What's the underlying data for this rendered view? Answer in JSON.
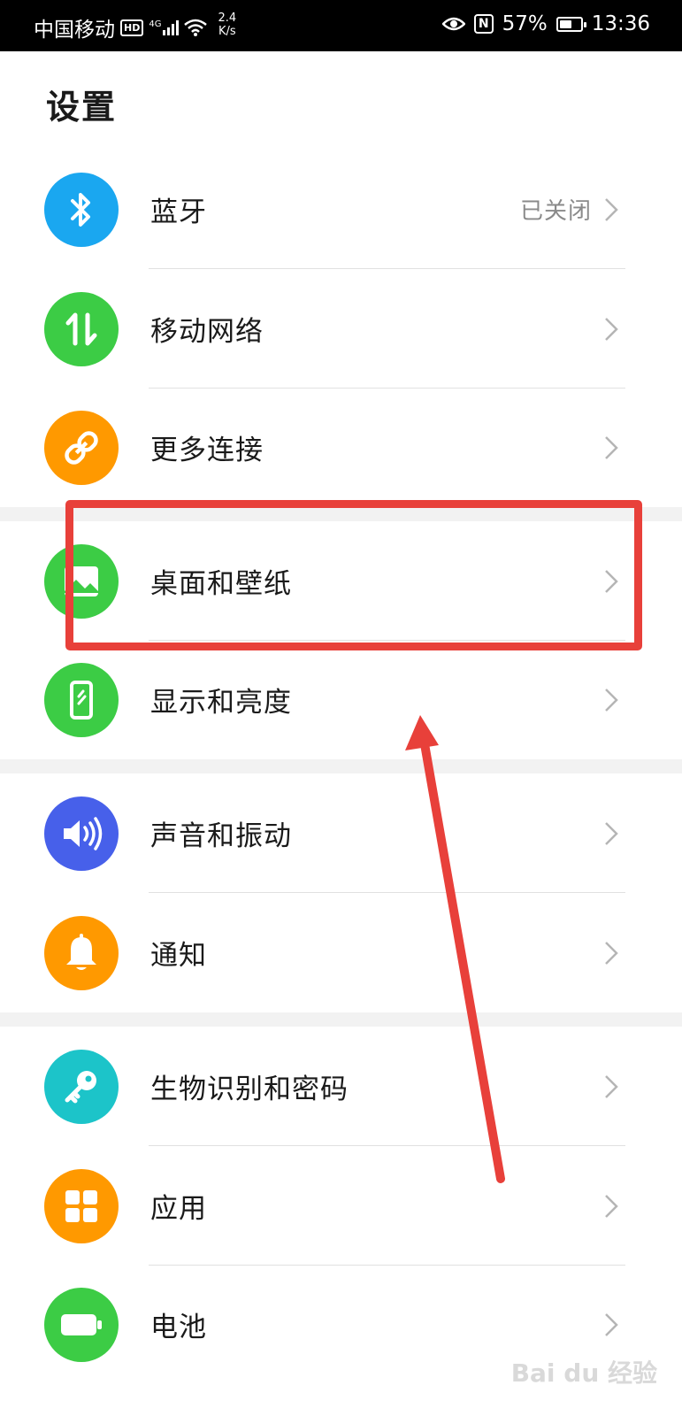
{
  "status_bar": {
    "carrier": "中国移动",
    "hd": "HD",
    "network": "4G",
    "speed_value": "2.4",
    "speed_unit": "K/s",
    "nfc": "N",
    "battery_percent": "57%",
    "battery_level": 0.57,
    "time": "13:36"
  },
  "page_title": "设置",
  "items": [
    {
      "label": "蓝牙",
      "status": "已关闭",
      "icon": "bluetooth-icon",
      "color": "#1aa7f0"
    },
    {
      "label": "移动网络",
      "status": "",
      "icon": "mobile-data-icon",
      "color": "#3ccc45"
    },
    {
      "label": "更多连接",
      "status": "",
      "icon": "link-icon",
      "color": "#ff9900"
    },
    {
      "label": "桌面和壁纸",
      "status": "",
      "icon": "wallpaper-icon",
      "color": "#3ccc45"
    },
    {
      "label": "显示和亮度",
      "status": "",
      "icon": "display-icon",
      "color": "#3ccc45"
    },
    {
      "label": "声音和振动",
      "status": "",
      "icon": "sound-icon",
      "color": "#4760ea"
    },
    {
      "label": "通知",
      "status": "",
      "icon": "bell-icon",
      "color": "#ff9900"
    },
    {
      "label": "生物识别和密码",
      "status": "",
      "icon": "key-icon",
      "color": "#1cc4c9"
    },
    {
      "label": "应用",
      "status": "",
      "icon": "apps-icon",
      "color": "#ff9900"
    },
    {
      "label": "电池",
      "status": "",
      "icon": "battery-icon",
      "color": "#3ccc45"
    }
  ],
  "annotation_color": "#e8403a",
  "watermark": "Bai du 经验"
}
